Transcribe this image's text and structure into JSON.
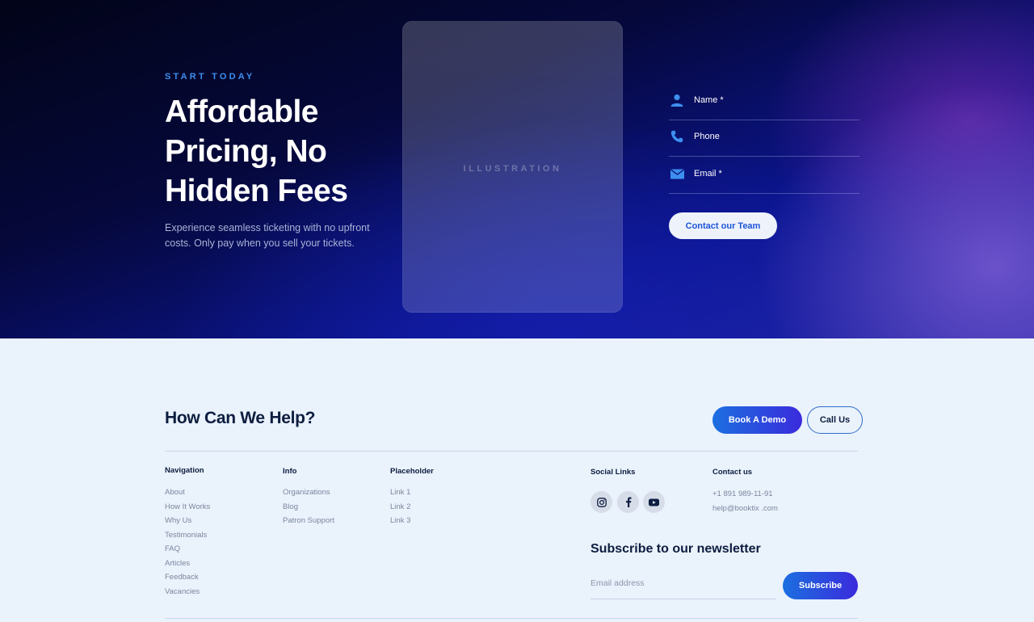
{
  "hero": {
    "eyebrow": "START TODAY",
    "title": "Affordable Pricing, No Hidden Fees",
    "description": "Experience seamless ticketing with no upfront costs. Only pay when you sell your tickets.",
    "illustration_label": "ILLUSTRATION"
  },
  "form": {
    "fields": [
      {
        "label": "Name *",
        "icon": "user-icon"
      },
      {
        "label": "Phone",
        "icon": "phone-icon"
      },
      {
        "label": "Email *",
        "icon": "mail-icon"
      }
    ],
    "submit_label": "Contact our Team"
  },
  "help": {
    "title": "How Can We Help?",
    "demo_label": "Book A Demo",
    "call_label": "Call Us"
  },
  "footer": {
    "navigation": {
      "heading": "Navigation",
      "items": [
        "About",
        "How It Works",
        "Why Us",
        "Testimonials",
        "FAQ",
        "Articles",
        "Feedback",
        "Vacancies"
      ]
    },
    "info": {
      "heading": "Info",
      "items": [
        "Organizations",
        "Blog",
        "Patron Support"
      ]
    },
    "placeholder": {
      "heading": "Placeholder",
      "items": [
        "Link 1",
        "Link 2",
        "Link 3"
      ]
    },
    "social": {
      "heading": "Social Links",
      "icons": [
        "instagram-icon",
        "facebook-icon",
        "youtube-icon"
      ]
    },
    "contact": {
      "heading": "Contact us",
      "phone": "+1 891 989-11-91",
      "email": "help@booktix .com"
    }
  },
  "newsletter": {
    "title": "Subscribe to our newsletter",
    "placeholder": "Email address",
    "button_label": "Subscribe"
  },
  "colors": {
    "accent": "#3d8ff0",
    "button_gradient_start": "#1c6fe0",
    "button_gradient_end": "#3a2bdc",
    "footer_bg": "#eaf2fc",
    "heading_text": "#0d1d3f"
  }
}
